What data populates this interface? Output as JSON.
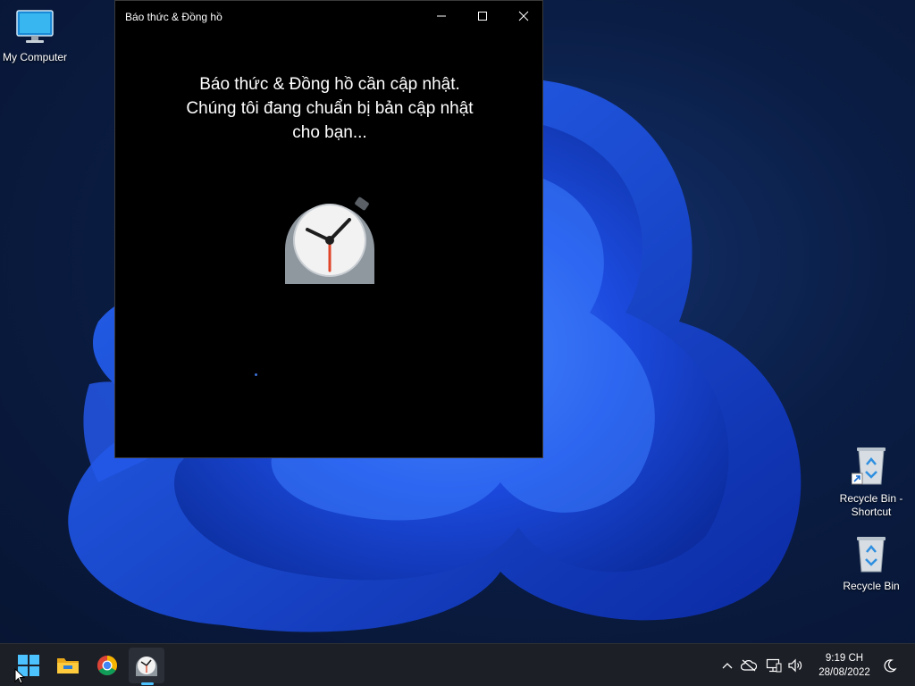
{
  "desktop": {
    "icons": [
      {
        "label": "My Computer",
        "icon": "monitor-icon"
      },
      {
        "label": "Recycle Bin - Shortcut",
        "icon": "recycle-bin-shortcut-icon"
      },
      {
        "label": "Recycle Bin",
        "icon": "recycle-bin-icon"
      }
    ]
  },
  "window": {
    "title": "Báo thức & Đồng hồ",
    "controls": {
      "minimize": "minimize-icon",
      "maximize": "maximize-icon",
      "close": "close-icon"
    },
    "message_lines": [
      "Báo thức & Đồng hồ cần cập nhật.",
      "Chúng tôi đang chuẩn bị bản cập nhật",
      "cho bạn..."
    ],
    "logo": "alarm-clock-icon"
  },
  "taskbar": {
    "apps": [
      {
        "name": "start",
        "icon": "windows-logo-icon"
      },
      {
        "name": "file-explorer",
        "icon": "folder-icon"
      },
      {
        "name": "chrome",
        "icon": "chrome-icon"
      },
      {
        "name": "alarms-clock",
        "icon": "alarm-clock-icon",
        "active": true
      }
    ],
    "tray": {
      "icons": [
        "chevron-up-icon",
        "cloud-off-icon",
        "network-icon",
        "volume-icon",
        "moon-icon"
      ],
      "time": "9:19 CH",
      "date": "28/08/2022"
    }
  },
  "colors": {
    "accent": "#4cc2ff",
    "window_bg": "#000000",
    "taskbar_bg": "#1c1f26",
    "wallpaper_blue": "#1e4ee8",
    "clock_hand_red": "#e0452a"
  }
}
